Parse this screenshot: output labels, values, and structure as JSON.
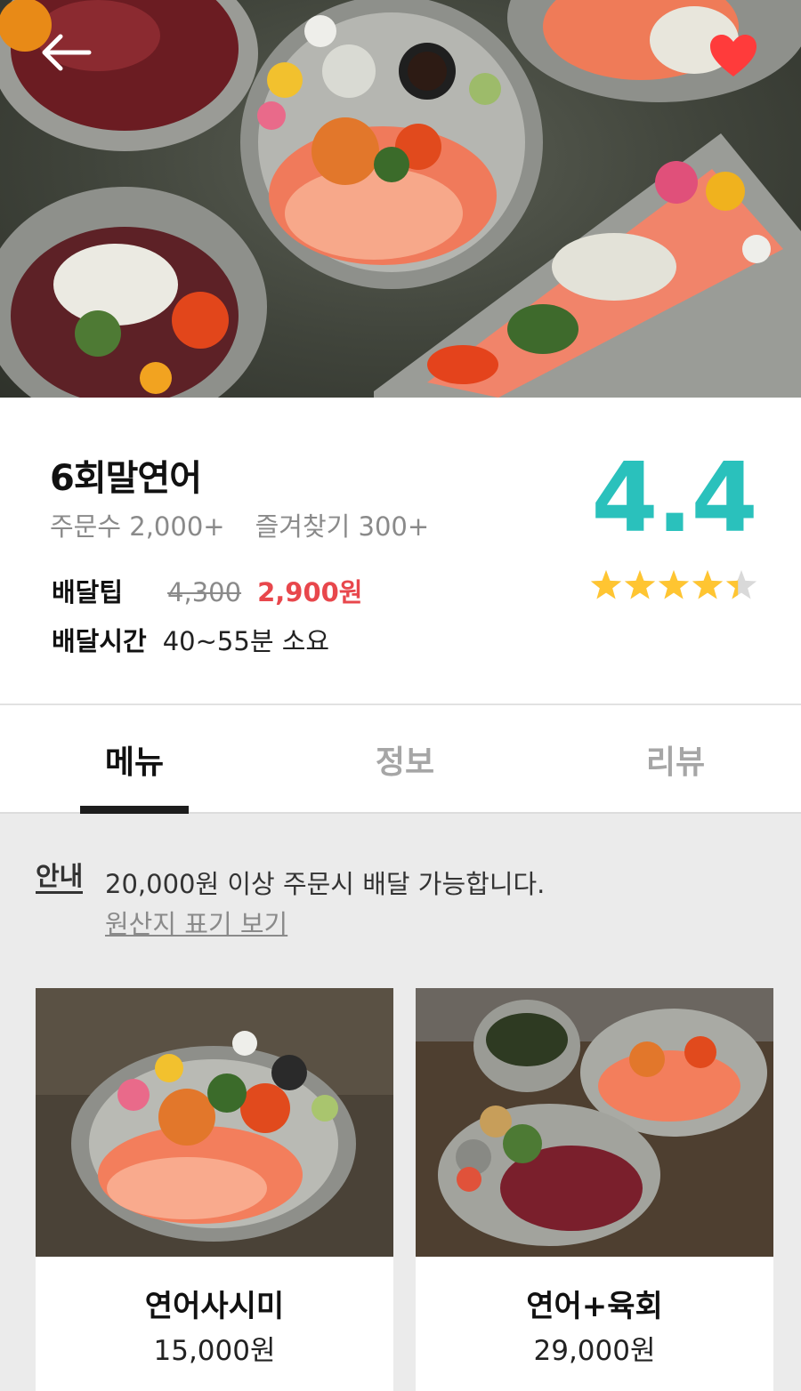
{
  "hero": {
    "back_icon": "arrow-left-icon",
    "favorite_icon": "heart-icon",
    "favorite_color": "#ff3b3b"
  },
  "store": {
    "name": "6회말연어",
    "order_count": "주문수 2,000+",
    "favorites_count": "즐겨찾기 300+",
    "delivery_tip_label": "배달팁",
    "delivery_tip_original": "4,300",
    "delivery_tip_discounted": "2,900원",
    "delivery_time_label": "배달시간",
    "delivery_time_value": "40~55분 소요",
    "rating": "4.4",
    "rating_value": 4.4,
    "rating_max": 5,
    "rating_color": "#2ac1bc",
    "star_color": "#ffc531"
  },
  "tabs": [
    {
      "label": "메뉴",
      "active": true
    },
    {
      "label": "정보",
      "active": false
    },
    {
      "label": "리뷰",
      "active": false
    }
  ],
  "notice": {
    "tag": "안내",
    "text": "20,000원 이상 주문시 배달 가능합니다.",
    "link": "원산지 표기 보기"
  },
  "menu_items": [
    {
      "name": "연어사시미",
      "price": "15,000원"
    },
    {
      "name": "연어+육회",
      "price": "29,000원"
    }
  ]
}
